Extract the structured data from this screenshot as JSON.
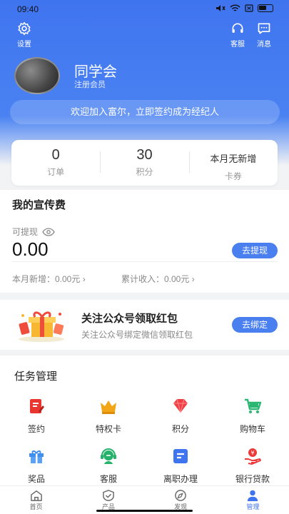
{
  "status_bar": {
    "time": "09:40",
    "signal_text": "ᯤ",
    "battery_icon": "battery-icon"
  },
  "header": {
    "settings_label": "设置",
    "service_label": "客服",
    "messages_label": "消息"
  },
  "profile": {
    "name": "同学会",
    "level": "注册会员"
  },
  "banner": {
    "text": "欢迎加入富尔，立即签约成为经纪人"
  },
  "stats": [
    {
      "value": "0",
      "label": "订单"
    },
    {
      "value": "30",
      "label": "积分"
    },
    {
      "value": "本月无新增",
      "label": "卡券"
    }
  ],
  "fees": {
    "title": "我的宣传费",
    "withdrawable_label": "可提现",
    "amount": "0.00",
    "withdraw_button": "去提现",
    "monthly_new": "本月新增：0.00元",
    "total_income": "累计收入：0.00元"
  },
  "promo": {
    "title": "关注公众号领取红包",
    "subtitle": "关注公众号绑定微信领取红包",
    "button": "去绑定"
  },
  "tasks": {
    "title": "任务管理",
    "items": [
      {
        "label": "签约",
        "icon": "sign-icon",
        "color": "#e8352f"
      },
      {
        "label": "特权卡",
        "icon": "crown-icon",
        "color": "#f2a516"
      },
      {
        "label": "积分",
        "icon": "diamond-icon",
        "color": "#ef3f45"
      },
      {
        "label": "购物车",
        "icon": "cart-icon",
        "color": "#2bb673"
      },
      {
        "label": "奖品",
        "icon": "gift-icon",
        "color": "#3e8ff0"
      },
      {
        "label": "客服",
        "icon": "headset-icon",
        "color": "#27b26b"
      },
      {
        "label": "离职办理",
        "icon": "document-icon",
        "color": "#3f74ef"
      },
      {
        "label": "银行贷款",
        "icon": "loan-icon",
        "color": "#ec3a3a"
      }
    ]
  },
  "tabbar": {
    "items": [
      {
        "label": "首页",
        "icon": "home-icon"
      },
      {
        "label": "产品",
        "icon": "product-icon"
      },
      {
        "label": "发现",
        "icon": "compass-icon"
      },
      {
        "label": "管理",
        "icon": "person-icon",
        "active": true
      }
    ]
  },
  "colors": {
    "primary": "#3f74ef",
    "accent_button": "#4a7ff0"
  }
}
